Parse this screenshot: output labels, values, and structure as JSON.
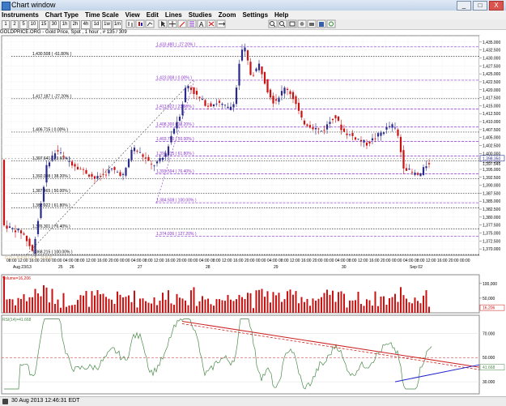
{
  "window": {
    "title": "Chart window",
    "minimize": "_",
    "maximize": "□",
    "close": "X"
  },
  "menu": [
    "Instruments",
    "Chart Type",
    "Time Scale",
    "View",
    "Edit",
    "Lines",
    "Studies",
    "Zoom",
    "Settings",
    "Help"
  ],
  "toolbar_labels": [
    "1",
    "2",
    "5",
    "10",
    "15",
    "30",
    "1h",
    "2h",
    "4h",
    "1d",
    "1w",
    "1m"
  ],
  "info": "GOLDPRICE.ORG - Gold Price, Spot , 1 hour , # 135 / 309",
  "watermark": "G O L D P R I C E . O R G",
  "colors": {
    "up": "#2a2a8a",
    "down": "#cc1111",
    "fib": "#8833cc",
    "rsi": "#4b8a4b",
    "trend": "#cc2222",
    "support": "#2222cc",
    "volume": "#cc1111"
  },
  "price_axis": {
    "min": 1368,
    "max": 1437,
    "ticks": [
      "1,435.000",
      "1,432.500",
      "1,430.000",
      "1,427.500",
      "1,425.000",
      "1,422.500",
      "1,420.000",
      "1,417.500",
      "1,415.000",
      "1,412.500",
      "1,410.000",
      "1,407.500",
      "1,405.000",
      "1,402.500",
      "1,400.000",
      "1,397.500",
      "1,395.000",
      "1,392.500",
      "1,390.000",
      "1,387.500",
      "1,385.000",
      "1,382.500",
      "1,380.000",
      "1,377.500",
      "1,375.000",
      "1,372.500",
      "1,370.000"
    ],
    "last_price": "1,398.350",
    "last_price2": "1,397.545"
  },
  "fib_black": [
    {
      "label": "1,430.508 ( -61.80% )",
      "price": 1430.508
    },
    {
      "label": "1,417.187 ( -27.20% )",
      "price": 1417.187
    },
    {
      "label": "1,406.715 ( 0.00% )",
      "price": 1406.715
    },
    {
      "label": "1,397.641 ( 23.60% )",
      "price": 1397.641
    },
    {
      "label": "1,392.008 ( 38.20% )",
      "price": 1392.008
    },
    {
      "label": "1,387.465 ( 50.00% )",
      "price": 1387.465
    },
    {
      "label": "1,382.922 ( 61.80% )",
      "price": 1382.922
    },
    {
      "label": "1,376.301 ( 76.40% )",
      "price": 1376.301
    },
    {
      "label": "1,368.215 ( 100.00% )",
      "price": 1368.215
    }
  ],
  "fib_purple": [
    {
      "label": "1,433.480 ( -27.20% )",
      "price": 1433.48
    },
    {
      "label": "1,423.008 ( 0.00% )",
      "price": 1423.008
    },
    {
      "label": "1,413.922 ( 23.60% )",
      "price": 1413.922
    },
    {
      "label": "1,408.300 ( 38.20% )",
      "price": 1408.3
    },
    {
      "label": "1,403.750 ( 50.00% )",
      "price": 1403.75
    },
    {
      "label": "1,399.215 ( 61.80% )",
      "price": 1399.215
    },
    {
      "label": "1,393.594 ( 76.40% )",
      "price": 1393.594
    },
    {
      "label": "1,384.508 ( 100.00% )",
      "price": 1384.508
    },
    {
      "label": "1,374.036 ( 127.20% )",
      "price": 1374.036
    }
  ],
  "time_axis": {
    "hours": [
      "08:00",
      "12:00",
      "16:00",
      "20:00",
      "00:00",
      "04:00",
      "08:00",
      "12:00",
      "16:00",
      "20:00",
      "00:00",
      "04:00",
      "08:00",
      "12:00",
      "16:00",
      "20:00",
      "00:00",
      "04:00",
      "08:00",
      "12:00",
      "16:00",
      "20:00",
      "00:00",
      "04:00",
      "08:00",
      "12:00",
      "16:00",
      "20:00",
      "00:00",
      "04:00",
      "08:00",
      "12:00",
      "16:00",
      "20:00",
      "00:00",
      "04:00",
      "08:00",
      "12:00",
      "16:00",
      "20:00",
      "00:00"
    ],
    "days": [
      {
        "label": "Aug 23/13",
        "i": 0
      },
      {
        "label": "25",
        "i": 4
      },
      {
        "label": "26",
        "i": 5
      },
      {
        "label": "27",
        "i": 11
      },
      {
        "label": "28",
        "i": 17
      },
      {
        "label": "29",
        "i": 23
      },
      {
        "label": "30",
        "i": 29
      },
      {
        "label": "Sep 02",
        "i": 35
      }
    ]
  },
  "volume": {
    "label": "Volume=16,206",
    "ticks": [
      "100,000",
      "50,000",
      "16,206"
    ],
    "max": 130000,
    "last": "16,206"
  },
  "rsi": {
    "label": "RSI(14)=41.668",
    "ticks": [
      "70.000",
      "50.000",
      "41.668",
      "30.000"
    ],
    "last": "41.668"
  },
  "status": "30 Aug 2013 12:46:31 EDT"
}
